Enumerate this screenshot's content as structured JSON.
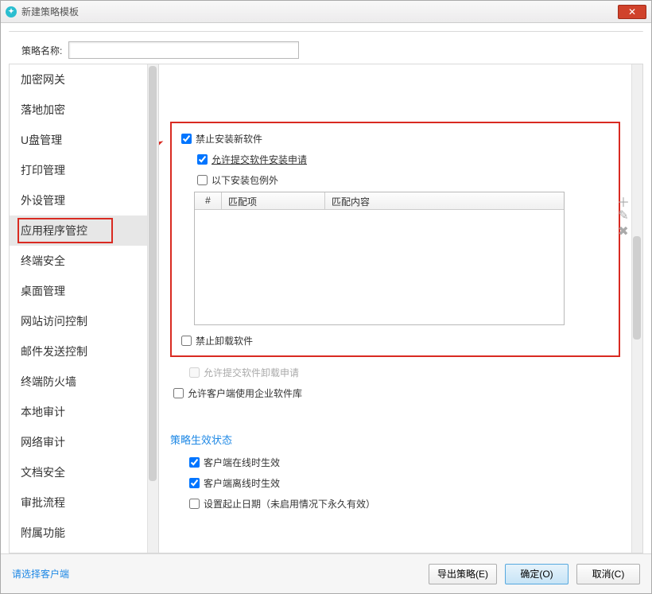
{
  "window": {
    "title": "新建策略模板"
  },
  "form": {
    "name_label": "策略名称:",
    "name_value": ""
  },
  "sidebar": {
    "items": [
      {
        "label": "加密网关"
      },
      {
        "label": "落地加密"
      },
      {
        "label": "U盘管理"
      },
      {
        "label": "打印管理"
      },
      {
        "label": "外设管理"
      },
      {
        "label": "应用程序管控"
      },
      {
        "label": "终端安全"
      },
      {
        "label": "桌面管理"
      },
      {
        "label": "网站访问控制"
      },
      {
        "label": "邮件发送控制"
      },
      {
        "label": "终端防火墙"
      },
      {
        "label": "本地审计"
      },
      {
        "label": "网络审计"
      },
      {
        "label": "文档安全"
      },
      {
        "label": "审批流程"
      },
      {
        "label": "附属功能"
      }
    ],
    "selected_index": 5
  },
  "panel": {
    "forbid_install": "禁止安装新软件",
    "allow_install_request": "允许提交软件安装申请",
    "package_exception": "以下安装包例外",
    "table": {
      "col_index": "#",
      "col_match_item": "匹配项",
      "col_match_content": "匹配内容",
      "rows": []
    },
    "tool_icons": {
      "plus": "plus-icon",
      "edit": "pencil-icon",
      "delete": "delete-icon"
    },
    "forbid_uninstall": "禁止卸载软件",
    "allow_uninstall_request": "允许提交软件卸载申请",
    "allow_enterprise_lib": "允许客户端使用企业软件库",
    "section_title": "策略生效状态",
    "client_online": "客户端在线时生效",
    "client_offline": "客户端离线时生效",
    "set_date": "设置起止日期（未启用情况下永久有效）"
  },
  "footer": {
    "select_client": "请选择客户端",
    "export": "导出策略(E)",
    "ok": "确定(O)",
    "cancel": "取消(C)"
  }
}
